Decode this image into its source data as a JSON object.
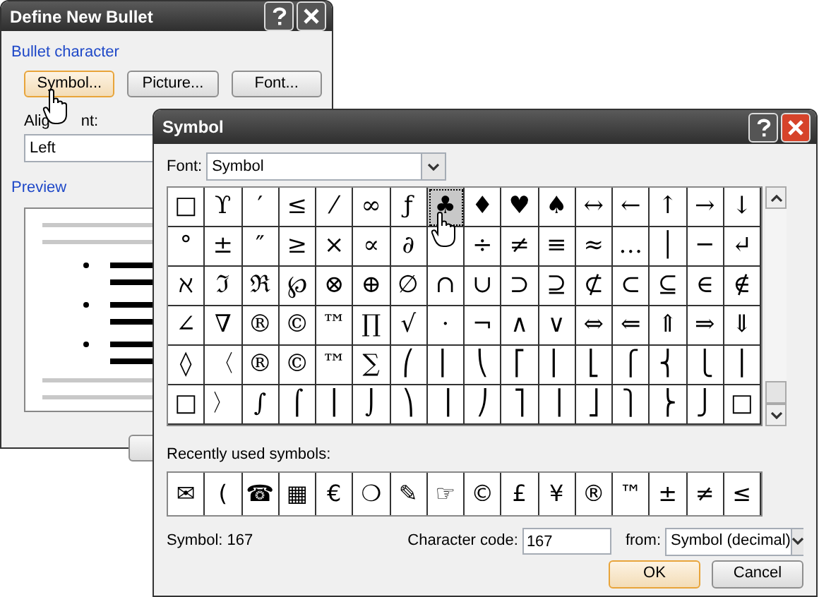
{
  "bullet_dialog": {
    "title": "Define New Bullet",
    "group_label": "Bullet character",
    "buttons": [
      {
        "label": "Symbol...",
        "selected": true
      },
      {
        "label": "Picture...",
        "selected": false
      },
      {
        "label": "Font...",
        "selected": false
      }
    ],
    "alignment_label_parts": [
      "Alig",
      "nt:"
    ],
    "alignment_value": "Left",
    "preview_label": "Preview"
  },
  "symbol_dialog": {
    "title": "Symbol",
    "font_label": "Font:",
    "font_value": "Symbol",
    "grid": [
      [
        {
          "char": "□",
          "selected": false
        },
        {
          "char": "ϒ",
          "selected": false
        },
        {
          "char": "′",
          "selected": false
        },
        {
          "char": "≤",
          "selected": false
        },
        {
          "char": "⁄",
          "selected": false
        },
        {
          "char": "∞",
          "selected": false
        },
        {
          "char": "ƒ",
          "selected": false
        },
        {
          "char": "♣",
          "selected": true
        },
        {
          "char": "♦",
          "selected": false
        },
        {
          "char": "♥",
          "selected": false
        },
        {
          "char": "♠",
          "selected": false
        },
        {
          "char": "↔",
          "selected": false
        },
        {
          "char": "←",
          "selected": false
        },
        {
          "char": "↑",
          "selected": false
        },
        {
          "char": "→",
          "selected": false
        },
        {
          "char": "↓",
          "selected": false
        }
      ],
      [
        {
          "char": "°",
          "selected": false
        },
        {
          "char": "±",
          "selected": false
        },
        {
          "char": "″",
          "selected": false
        },
        {
          "char": "≥",
          "selected": false
        },
        {
          "char": "×",
          "selected": false
        },
        {
          "char": "∝",
          "selected": false
        },
        {
          "char": "∂",
          "selected": false
        },
        {
          "selected": false
        },
        {
          "char": "÷",
          "selected": false
        },
        {
          "char": "≠",
          "selected": false
        },
        {
          "char": "≡",
          "selected": false
        },
        {
          "char": "≈",
          "selected": false
        },
        {
          "char": "…",
          "selected": false
        },
        {
          "char": "│",
          "selected": false
        },
        {
          "char": "─",
          "selected": false
        },
        {
          "char": "↵",
          "selected": false
        }
      ],
      [
        {
          "char": "ℵ",
          "selected": false
        },
        {
          "char": "ℑ",
          "selected": false
        },
        {
          "char": "ℜ",
          "selected": false
        },
        {
          "char": "℘",
          "selected": false
        },
        {
          "char": "⊗",
          "selected": false
        },
        {
          "char": "⊕",
          "selected": false
        },
        {
          "char": "∅",
          "selected": false
        },
        {
          "char": "∩",
          "selected": false
        },
        {
          "char": "∪",
          "selected": false
        },
        {
          "char": "⊃",
          "selected": false
        },
        {
          "char": "⊇",
          "selected": false
        },
        {
          "char": "⊄",
          "selected": false
        },
        {
          "char": "⊂",
          "selected": false
        },
        {
          "char": "⊆",
          "selected": false
        },
        {
          "char": "∈",
          "selected": false
        },
        {
          "char": "∉",
          "selected": false
        }
      ],
      [
        {
          "char": "∠",
          "selected": false
        },
        {
          "char": "∇",
          "selected": false
        },
        {
          "char": "®",
          "selected": false
        },
        {
          "char": "©",
          "selected": false
        },
        {
          "char": "™",
          "selected": false
        },
        {
          "char": "∏",
          "selected": false
        },
        {
          "char": "√",
          "selected": false
        },
        {
          "char": "⋅",
          "selected": false
        },
        {
          "char": "¬",
          "selected": false
        },
        {
          "char": "∧",
          "selected": false
        },
        {
          "char": "∨",
          "selected": false
        },
        {
          "char": "⇔",
          "selected": false
        },
        {
          "char": "⇐",
          "selected": false
        },
        {
          "char": "⇑",
          "selected": false
        },
        {
          "char": "⇒",
          "selected": false
        },
        {
          "char": "⇓",
          "selected": false
        }
      ],
      [
        {
          "char": "◊",
          "selected": false
        },
        {
          "char": "〈",
          "selected": false
        },
        {
          "char": "®",
          "selected": false
        },
        {
          "char": "©",
          "selected": false
        },
        {
          "char": "™",
          "selected": false
        },
        {
          "char": "∑",
          "selected": false
        },
        {
          "char": "⎛",
          "selected": false
        },
        {
          "char": "⎜",
          "selected": false
        },
        {
          "char": "⎝",
          "selected": false
        },
        {
          "char": "⎡",
          "selected": false
        },
        {
          "char": "⎢",
          "selected": false
        },
        {
          "char": "⎣",
          "selected": false
        },
        {
          "char": "⎧",
          "selected": false
        },
        {
          "char": "⎨",
          "selected": false
        },
        {
          "char": "⎩",
          "selected": false
        },
        {
          "char": "⎪",
          "selected": false
        }
      ],
      [
        {
          "char": "□",
          "selected": false
        },
        {
          "char": "〉",
          "selected": false
        },
        {
          "char": "∫",
          "selected": false
        },
        {
          "char": "⌠",
          "selected": false
        },
        {
          "char": "⎮",
          "selected": false
        },
        {
          "char": "⌡",
          "selected": false
        },
        {
          "char": "⎞",
          "selected": false
        },
        {
          "char": "⎟",
          "selected": false
        },
        {
          "char": "⎠",
          "selected": false
        },
        {
          "char": "⎤",
          "selected": false
        },
        {
          "char": "⎥",
          "selected": false
        },
        {
          "char": "⎦",
          "selected": false
        },
        {
          "char": "⎫",
          "selected": false
        },
        {
          "char": "⎬",
          "selected": false
        },
        {
          "char": "⎭",
          "selected": false
        },
        {
          "char": "□",
          "selected": false
        }
      ]
    ],
    "recent_label": "Recently used symbols:",
    "recent": [
      "✉",
      "(",
      "☎",
      "▦",
      "€",
      "❍",
      "✎",
      "☞",
      "©",
      "£",
      "¥",
      "®",
      "™",
      "±",
      "≠",
      "≤"
    ],
    "symbol_info": "Symbol: 167",
    "char_code_label": "Character code:",
    "char_code_value": "167",
    "from_label": "from:",
    "from_value": "Symbol (decimal)",
    "ok": "OK",
    "cancel": "Cancel"
  }
}
